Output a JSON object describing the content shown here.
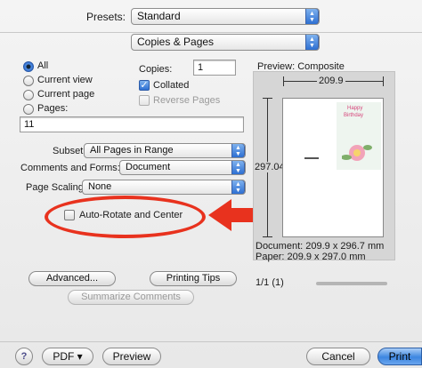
{
  "presets": {
    "label": "Presets:",
    "value": "Standard"
  },
  "pane": {
    "value": "Copies & Pages"
  },
  "pages": {
    "all": "All",
    "current_view": "Current view",
    "current_page": "Current page",
    "pages": "Pages:",
    "pages_value": "11"
  },
  "copies": {
    "label": "Copies:",
    "value": "1",
    "collated": "Collated",
    "reverse": "Reverse Pages"
  },
  "subset": {
    "label": "Subset:",
    "value": "All Pages in Range"
  },
  "comments": {
    "label": "Comments and Forms:",
    "value": "Document"
  },
  "scaling": {
    "label": "Page Scaling:",
    "value": "None"
  },
  "auto_rotate": {
    "label": "Auto-Rotate and Center"
  },
  "preview": {
    "title": "Preview: Composite",
    "width_dim": "209.9",
    "height_dim": "297.04",
    "card_line1": "Happy",
    "card_line2": "Birthday",
    "document_size": "Document: 209.9 x 296.7 mm",
    "paper_size": "Paper: 209.9 x 297.0 mm",
    "page_count": "1/1 (1)"
  },
  "buttons": {
    "advanced": "Advanced...",
    "printing_tips": "Printing Tips",
    "summarize": "Summarize Comments",
    "help": "?",
    "pdf": "PDF ▾",
    "preview": "Preview",
    "cancel": "Cancel",
    "print": "Print"
  },
  "colors": {
    "annotation": "#e8321e",
    "accent": "#2d6fd2"
  }
}
